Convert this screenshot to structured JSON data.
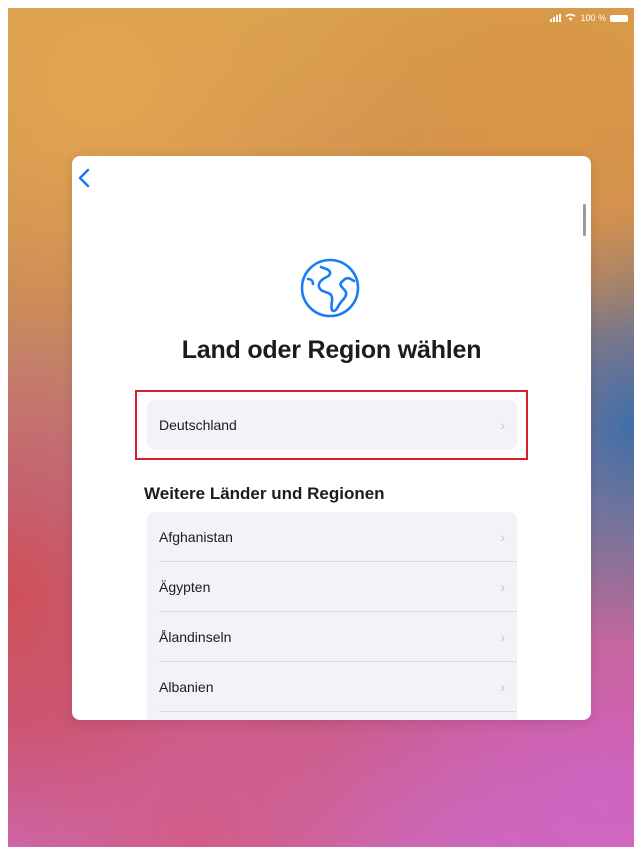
{
  "status_bar": {
    "battery_text": "100 %"
  },
  "back_icon": "chevron-left-icon",
  "title": "Land oder Region wählen",
  "selected_country": {
    "label": "Deutschland"
  },
  "section_heading": "Weitere Länder und Regionen",
  "countries": [
    {
      "label": "Afghanistan"
    },
    {
      "label": "Ägypten"
    },
    {
      "label": "Ålandinseln"
    },
    {
      "label": "Albanien"
    },
    {
      "label": ""
    }
  ],
  "colors": {
    "accent": "#1a7cf5",
    "highlight_border": "#d51f2b",
    "row_background": "#f2f2f7"
  }
}
